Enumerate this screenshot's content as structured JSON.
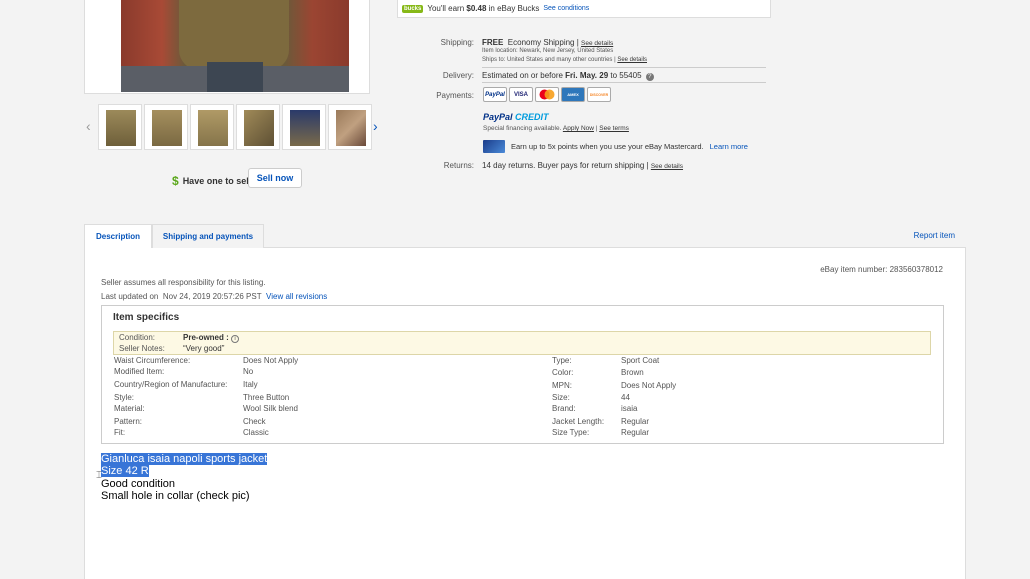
{
  "left": {
    "sell_prompt": "Have one to sell?",
    "sell_button": "Sell now"
  },
  "bucks": {
    "badge": "bucks",
    "text_pre": "You'll earn ",
    "amount": "$0.48",
    "text_post": " in eBay Bucks",
    "link": "See conditions"
  },
  "shipping": {
    "label": "Shipping:",
    "free": "FREE",
    "method": "Economy Shipping |",
    "details": "See details",
    "location": "Item location:  Newark, New Jersey, United States",
    "ships_to_pre": "Ships to:  United States and many other countries |",
    "ships_to_link": "See details"
  },
  "delivery": {
    "label": "Delivery:",
    "text": "Estimated on or before",
    "date": "Fri. May. 29",
    "to": "to 55405"
  },
  "payments": {
    "label": "Payments:",
    "cards": [
      "PayPal",
      "VISA",
      "MC",
      "AMEX",
      "DISCOVER"
    ],
    "paypal_credit_a": "PayPal",
    "paypal_credit_b": "CREDIT",
    "financing": "Special financing available.",
    "apply": "Apply Now",
    "sep": "|",
    "terms": "See terms",
    "mastercard": "Earn up to 5x points when you use your eBay Mastercard.",
    "learn_more": "Learn more"
  },
  "returns": {
    "label": "Returns:",
    "text": "14 day returns. Buyer pays for return shipping |",
    "details": "See details"
  },
  "tabs": {
    "description": "Description",
    "shipping": "Shipping and payments",
    "report": "Report item"
  },
  "listing": {
    "ebay_item_number": "eBay item number:   283560378012",
    "seller_assumes": "Seller assumes all responsibility for this listing.",
    "last_updated_label": "Last updated on",
    "last_updated": "Nov 24, 2019 20:57:26 PST",
    "view_revisions": "View all revisions"
  },
  "specifics": {
    "title": "Item specifics",
    "condition_label": "Condition:",
    "condition_value": "Pre-owned :",
    "seller_notes_label": "Seller Notes:",
    "seller_notes_value": "“Very good”",
    "left": [
      {
        "k": "Waist Circumference:",
        "v": "Does Not Apply"
      },
      {
        "k": "Modified Item:",
        "v": "No"
      },
      {
        "k": "Country/Region of Manufacture:",
        "v": "Italy"
      },
      {
        "k": "Style:",
        "v": "Three Button"
      },
      {
        "k": "Material:",
        "v": "Wool Silk blend"
      },
      {
        "k": "Pattern:",
        "v": "Check"
      },
      {
        "k": "Fit:",
        "v": "Classic"
      }
    ],
    "right": [
      {
        "k": "Type:",
        "v": "Sport Coat"
      },
      {
        "k": "Color:",
        "v": "Brown"
      },
      {
        "k": "MPN:",
        "v": "Does Not Apply"
      },
      {
        "k": "Size:",
        "v": "44"
      },
      {
        "k": "Brand:",
        "v": "isaia"
      },
      {
        "k": "Jacket Length:",
        "v": "Regular"
      },
      {
        "k": "Size Type:",
        "v": "Regular"
      }
    ]
  },
  "description": {
    "line1": "Gianluca isaia napoli sports jacket",
    "line2": "Size 42 R",
    "line3": "Good condition",
    "line4": "Small hole in collar (check pic)"
  }
}
